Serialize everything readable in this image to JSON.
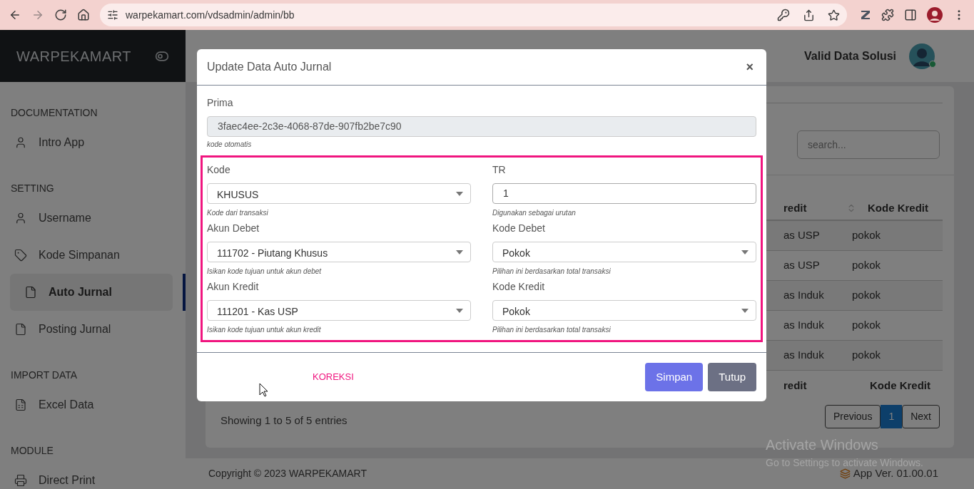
{
  "browser": {
    "url": "warpekamart.com/vdsadmin/admin/bb"
  },
  "sidebar": {
    "brand": "WARPEKAMART",
    "sections": [
      {
        "title": "DOCUMENTATION",
        "items": [
          {
            "label": "Intro App",
            "selected": false
          }
        ]
      },
      {
        "title": "SETTING",
        "items": [
          {
            "label": "Username",
            "selected": false
          },
          {
            "label": "Kode Simpanan",
            "selected": false
          },
          {
            "label": "Auto Jurnal",
            "selected": true
          },
          {
            "label": "Posting Jurnal",
            "selected": false
          }
        ]
      },
      {
        "title": "IMPORT DATA",
        "items": [
          {
            "label": "Excel Data",
            "selected": false
          }
        ]
      },
      {
        "title": "MODULE",
        "items": [
          {
            "label": "Direct Print",
            "selected": false
          }
        ]
      }
    ]
  },
  "header": {
    "user_name": "Valid Data Solusi"
  },
  "content": {
    "search": {
      "placeholder": "search..."
    },
    "table": {
      "columns": [
        "redit",
        "Kode Kredit"
      ],
      "rows": [
        [
          "as USP",
          "pokok"
        ],
        [
          "as USP",
          "pokok"
        ],
        [
          "as Induk",
          "pokok"
        ],
        [
          "as Induk",
          "pokok"
        ],
        [
          "as Induk",
          "pokok"
        ]
      ],
      "footer": [
        "redit",
        "Kode Kredit"
      ]
    },
    "info": "Showing 1 to 5 of 5 entries",
    "pagination": [
      {
        "label": "Previous",
        "selected": false
      },
      {
        "label": "1",
        "selected": true
      },
      {
        "label": "Next",
        "selected": false
      }
    ]
  },
  "footer": {
    "copyright": "Copyright © 2023 WARPEKAMART",
    "version": "App Ver. 01.00.01"
  },
  "os_notice": {
    "title": "Activate Windows",
    "subtitle": "Go to Settings to activate Windows."
  },
  "modal": {
    "title": "Update Data Auto Jurnal",
    "close": "×",
    "prima": {
      "label": "Prima",
      "value": "3faec4ee-2c3e-4068-87de-907fb2be7c90",
      "hint": "kode otomatis"
    },
    "fields": [
      {
        "kind": "select",
        "label": "Kode",
        "value": "KHUSUS",
        "hint": "Kode dari transaksi"
      },
      {
        "kind": "input",
        "label": "TR",
        "value": "1",
        "hint": "Digunakan sebagai urutan"
      },
      {
        "kind": "select",
        "label": "Akun Debet",
        "value": "111702 - Piutang Khusus",
        "hint": "Isikan kode tujuan untuk akun debet"
      },
      {
        "kind": "select",
        "label": "Kode Debet",
        "value": "Pokok",
        "hint": "Pilihan ini berdasarkan total transaksi"
      },
      {
        "kind": "select",
        "label": "Akun Kredit",
        "value": "111201 - Kas USP",
        "hint": "Isikan kode tujuan untuk akun kredit"
      },
      {
        "kind": "select",
        "label": "Kode Kredit",
        "value": "Pokok",
        "hint": "Pilihan ini berdasarkan total transaksi"
      }
    ],
    "note": "KOREKSI",
    "buttons": [
      {
        "label": "Simpan",
        "kind": "primary"
      },
      {
        "label": "Tutup",
        "kind": "secondary"
      }
    ]
  }
}
